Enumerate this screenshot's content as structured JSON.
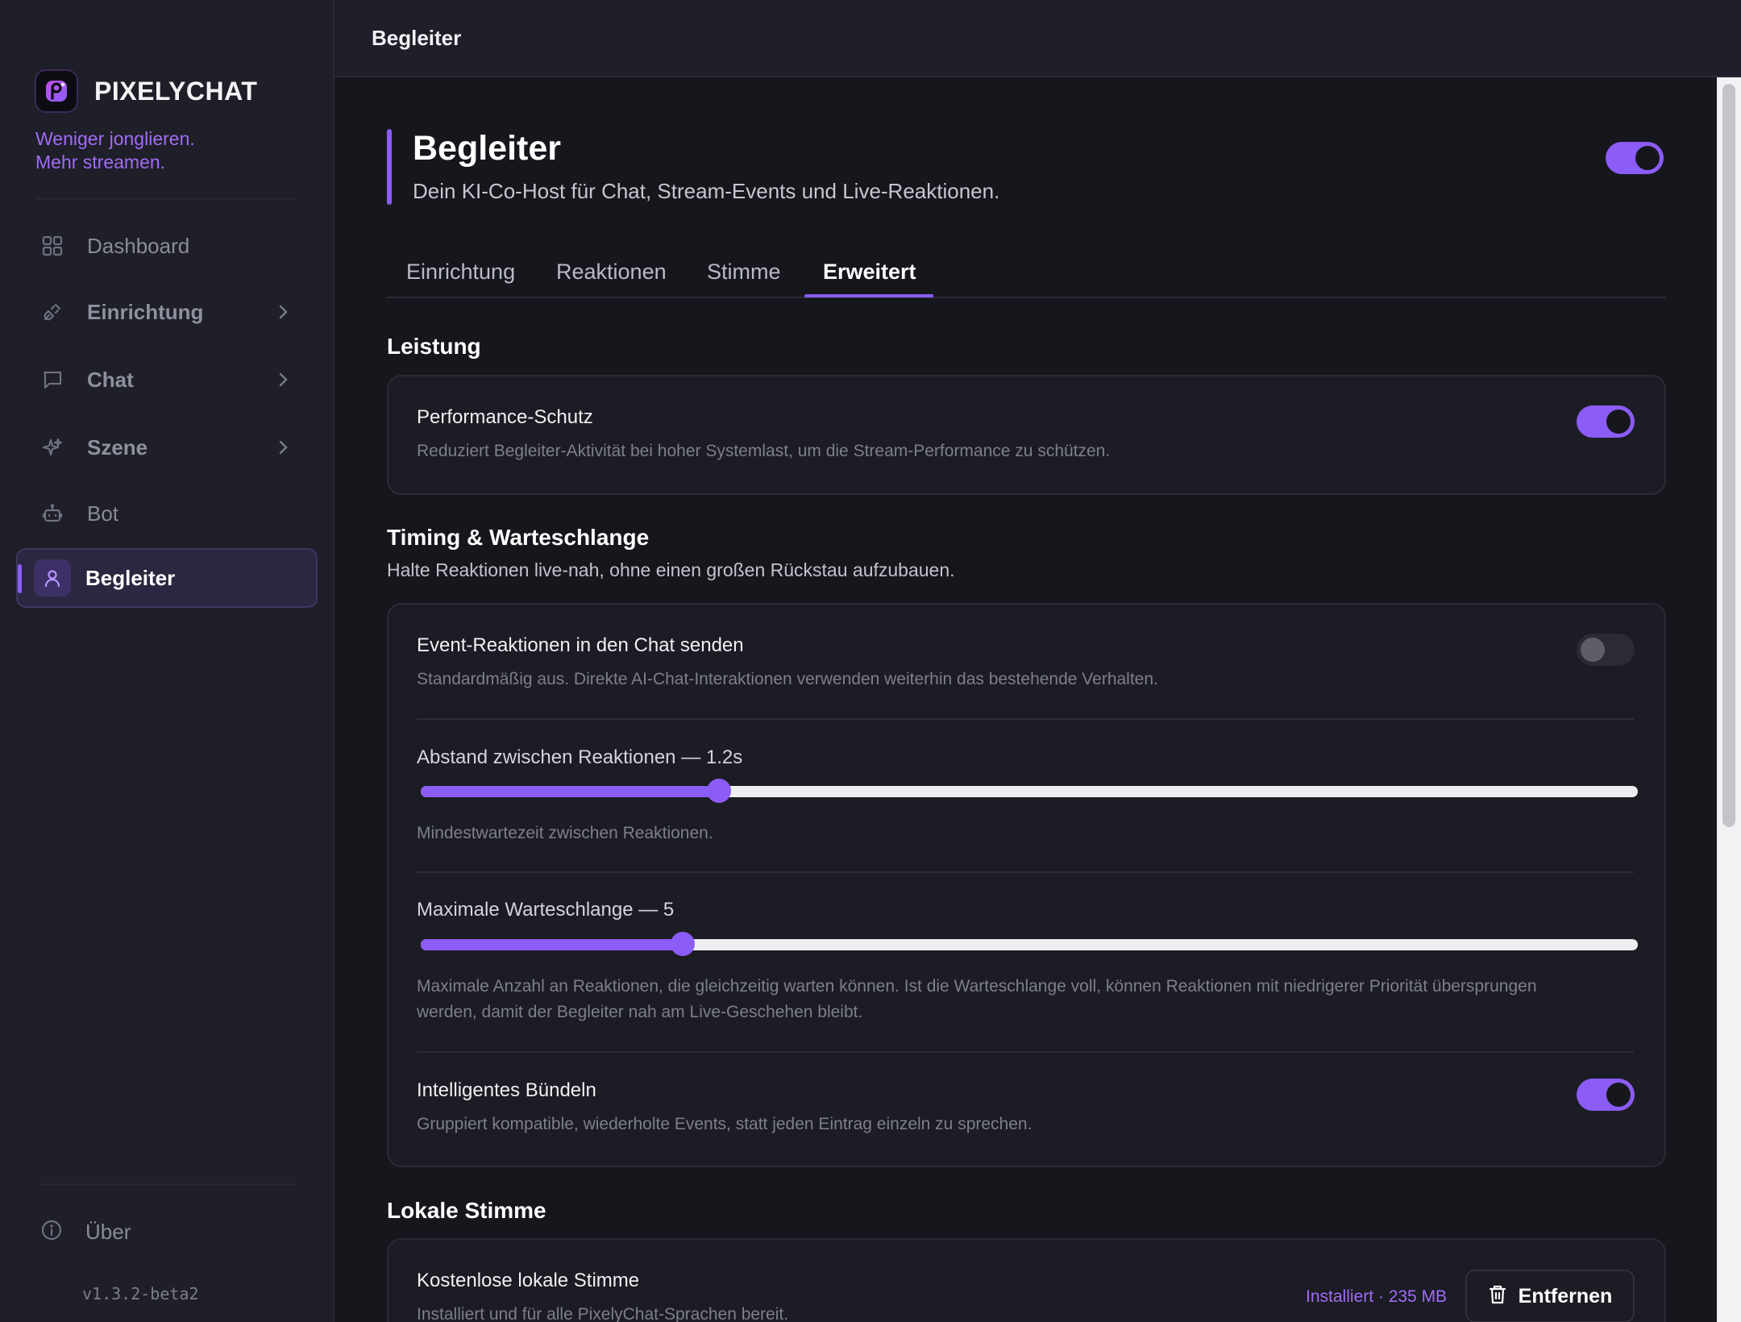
{
  "brand": {
    "name": "PIXELYCHAT",
    "tagline_line1": "Weniger jonglieren.",
    "tagline_line2": "Mehr streamen."
  },
  "sidebar": {
    "items": [
      {
        "label": "Dashboard",
        "icon": "grid-icon"
      },
      {
        "label": "Einrichtung",
        "icon": "plug-icon"
      },
      {
        "label": "Chat",
        "icon": "chat-bubble-icon"
      },
      {
        "label": "Szene",
        "icon": "sparkles-icon"
      },
      {
        "label": "Bot",
        "icon": "robot-icon"
      },
      {
        "label": "Begleiter",
        "icon": "user-icon",
        "active": true
      }
    ],
    "about_label": "Über",
    "version": "v1.3.2-beta2"
  },
  "topbar": {
    "title": "Begleiter"
  },
  "header": {
    "title": "Begleiter",
    "subtitle": "Dein KI-Co-Host für Chat, Stream-Events und Live-Reaktionen.",
    "enabled": true
  },
  "tabs": [
    {
      "label": "Einrichtung"
    },
    {
      "label": "Reaktionen"
    },
    {
      "label": "Stimme"
    },
    {
      "label": "Erweitert",
      "active": true
    }
  ],
  "performance": {
    "section_title": "Leistung",
    "title": "Performance-Schutz",
    "desc": "Reduziert Begleiter-Aktivität bei hoher Systemlast, um die Stream-Performance zu schützen.",
    "enabled": true
  },
  "timing": {
    "section_title": "Timing & Warteschlange",
    "section_sub": "Halte Reaktionen live-nah, ohne einen großen Rückstau aufzubauen.",
    "event_chat": {
      "title": "Event-Reaktionen in den Chat senden",
      "desc": "Standardmäßig aus. Direkte AI-Chat-Interaktionen verwenden weiterhin das bestehende Verhalten.",
      "enabled": false
    },
    "spacing": {
      "label": "Abstand zwischen Reaktionen — 1.2s",
      "desc": "Mindestwartezeit zwischen Reaktionen.",
      "fraction": 0.245
    },
    "queue": {
      "label": "Maximale Warteschlange — 5",
      "desc_line1": "Maximale Anzahl an Reaktionen, die gleichzeitig warten können. Ist die Warteschlange voll, können Reaktionen mit niedrigerer Priorität übersprungen",
      "desc_line2": "werden, damit der Begleiter nah am Live-Geschehen bleibt.",
      "fraction": 0.215
    },
    "bundling": {
      "title": "Intelligentes Bündeln",
      "desc": "Gruppiert kompatible, wiederholte Events, statt jeden Eintrag einzeln zu sprechen.",
      "enabled": true
    }
  },
  "local_voice": {
    "section_title": "Lokale Stimme",
    "title": "Kostenlose lokale Stimme",
    "desc": "Installiert und für alle PixelyChat-Sprachen bereit.",
    "status": "Installiert · 235 MB",
    "remove_label": "Entfernen"
  },
  "colors": {
    "accent": "#8b5cf6",
    "brand_text": "#a26bf5"
  }
}
